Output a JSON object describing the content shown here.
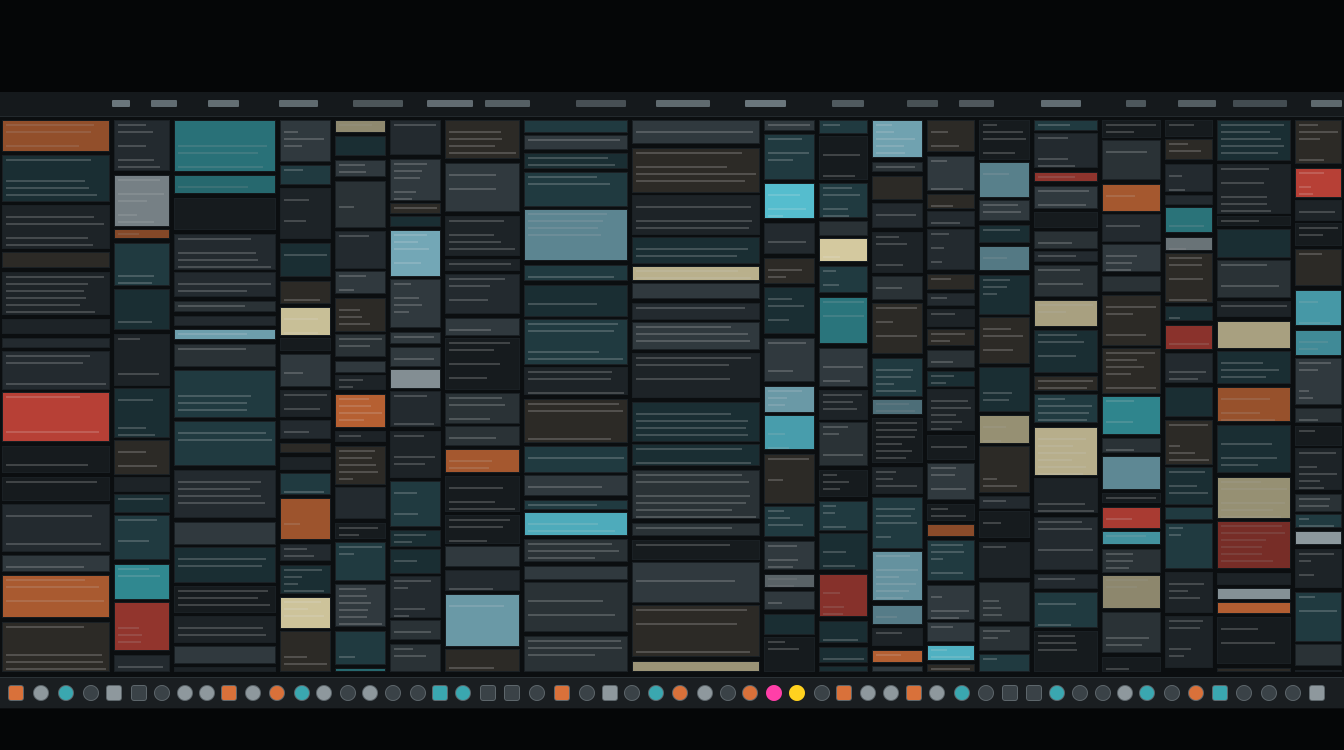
{
  "palette": {
    "background": "#050607",
    "panel": "#0b0e10",
    "accent_teal": "#3aa7b0",
    "accent_cyan": "#5fd3e6",
    "accent_orange": "#d9713a",
    "accent_cream": "#e8dcae",
    "accent_red": "#c9453a",
    "dock_magenta": "#ff3fa8",
    "dock_yellow": "#ffd21f"
  },
  "dock": {
    "highlighted_icons": [
      {
        "name": "magenta-app-icon",
        "color": "#ff3fa8"
      },
      {
        "name": "yellow-app-icon",
        "color": "#ffd21f"
      }
    ]
  }
}
